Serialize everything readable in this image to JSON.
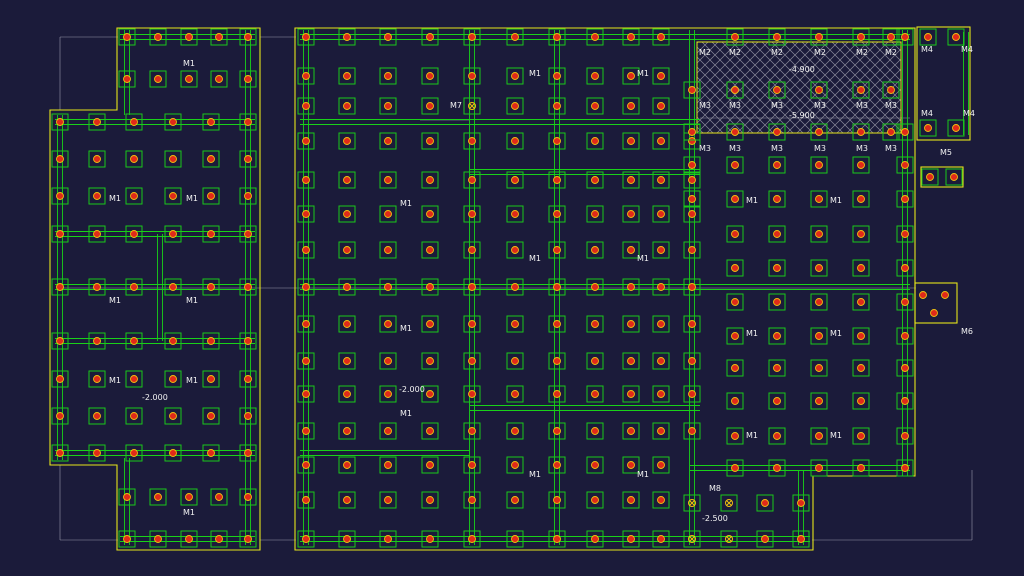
{
  "colors": {
    "background": "#1b1b3a",
    "outline": "#e6e619",
    "beam": "#19d219",
    "pile_box": "#19c819",
    "pile": "#e02a1a",
    "pile_ring": "#f0c010",
    "guide": "#9a9aaa",
    "hatch": "#8a8a9a",
    "text": "#f2f2f2"
  },
  "labels": {
    "m1": "M1",
    "m2": "M2",
    "m3": "M3",
    "m4": "M4",
    "m5": "M5",
    "m6": "M6",
    "m7": "M7",
    "m8": "M8"
  },
  "levels": {
    "left": "-2.000",
    "middle": "-2.000",
    "pit_upper": "-4.900",
    "pit_lower": "-5.900",
    "corner": "-2.500"
  }
}
